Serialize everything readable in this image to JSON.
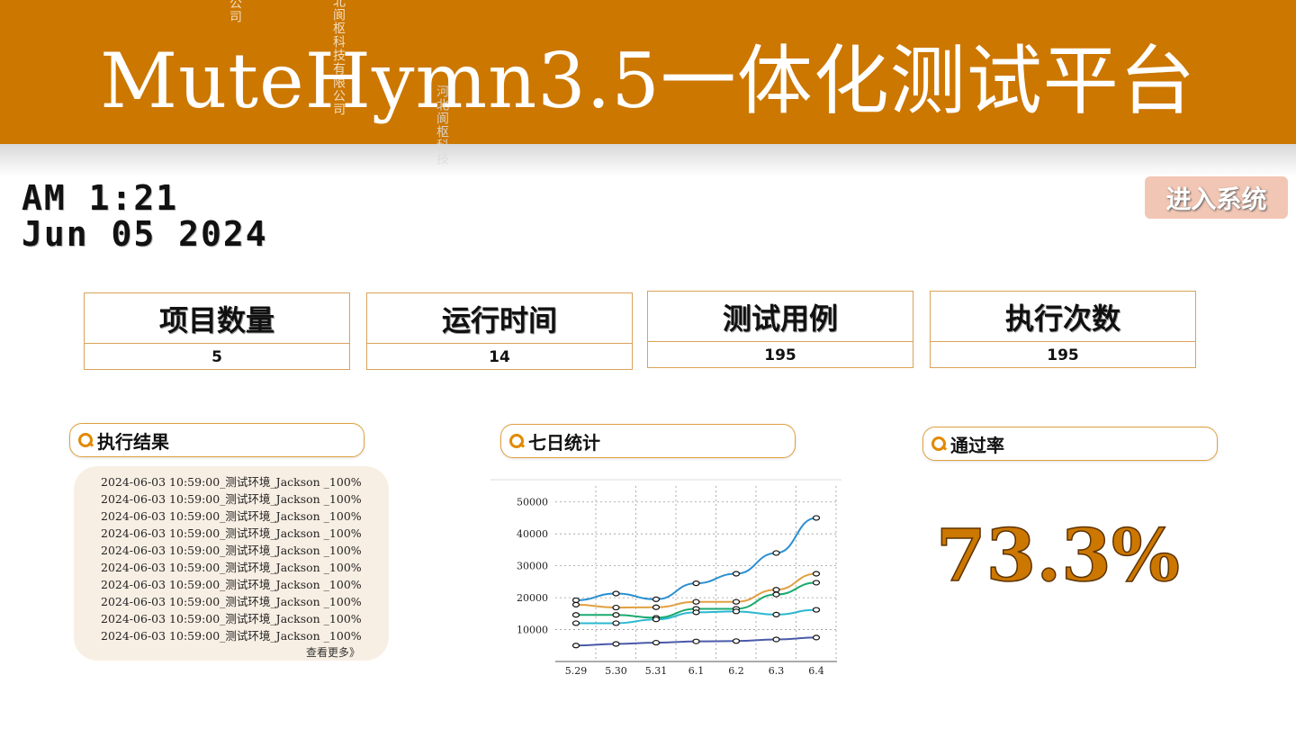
{
  "header": {
    "title": "MuteHymn3.5一体化测试平台",
    "watermarks": [
      "公司",
      "北阆枢科技有限公司",
      "河北阆枢科技"
    ]
  },
  "clock": {
    "time": "AM 1:21",
    "date": "Jun 05 2024"
  },
  "enter_button": "进入系统",
  "stats": [
    {
      "label": "项目数量",
      "value": "5"
    },
    {
      "label": "运行时间",
      "value": "14"
    },
    {
      "label": "测试用例",
      "value": "195"
    },
    {
      "label": "执行次数",
      "value": "195"
    }
  ],
  "panels": {
    "results": {
      "title": "执行结果",
      "items": [
        "2024-06-03 10:59:00_测试环境_Jackson _100%",
        "2024-06-03 10:59:00_测试环境_Jackson _100%",
        "2024-06-03 10:59:00_测试环境_Jackson _100%",
        "2024-06-03 10:59:00_测试环境_Jackson _100%",
        "2024-06-03 10:59:00_测试环境_Jackson _100%",
        "2024-06-03 10:59:00_测试环境_Jackson _100%",
        "2024-06-03 10:59:00_测试环境_Jackson _100%",
        "2024-06-03 10:59:00_测试环境_Jackson _100%",
        "2024-06-03 10:59:00_测试环境_Jackson _100%",
        "2024-06-03 10:59:00_测试环境_Jackson _100%"
      ],
      "more": "查看更多》"
    },
    "weekly": {
      "title": "七日统计"
    },
    "pass": {
      "title": "通过率",
      "value": "73.3%"
    }
  },
  "chart_data": {
    "type": "line",
    "categories": [
      "5.29",
      "5.30",
      "5.31",
      "6.1",
      "6.2",
      "6.3",
      "6.4"
    ],
    "ylim": [
      0,
      55000
    ],
    "yticks": [
      10000,
      20000,
      30000,
      40000,
      50000
    ],
    "grid": true,
    "series": [
      {
        "color": "#2a8fd0",
        "values": [
          19200,
          21300,
          19500,
          24500,
          27500,
          34000,
          45000
        ]
      },
      {
        "color": "#e0a040",
        "values": [
          17800,
          16900,
          17000,
          18700,
          18700,
          22500,
          27500
        ]
      },
      {
        "color": "#1aaa70",
        "values": [
          14600,
          14600,
          13700,
          16500,
          16500,
          21000,
          24700
        ]
      },
      {
        "color": "#2ab8d0",
        "values": [
          12000,
          12000,
          13200,
          15400,
          15700,
          14700,
          16200
        ]
      },
      {
        "color": "#4a5aa8",
        "values": [
          5000,
          5500,
          5900,
          6300,
          6400,
          6900,
          7500
        ]
      }
    ]
  }
}
